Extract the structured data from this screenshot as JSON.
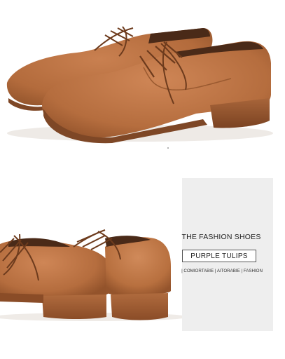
{
  "panel": {
    "headline": "THE FASHION SHOES",
    "brand": "PURPLE TULIPS",
    "tagline": "| COMIORTABIE | AITORABIE | FASHION"
  },
  "colors": {
    "suede": "#b56d3e",
    "suede_dark": "#8c4e28",
    "suede_light": "#cc8655",
    "panel_bg": "#eeeeee"
  }
}
